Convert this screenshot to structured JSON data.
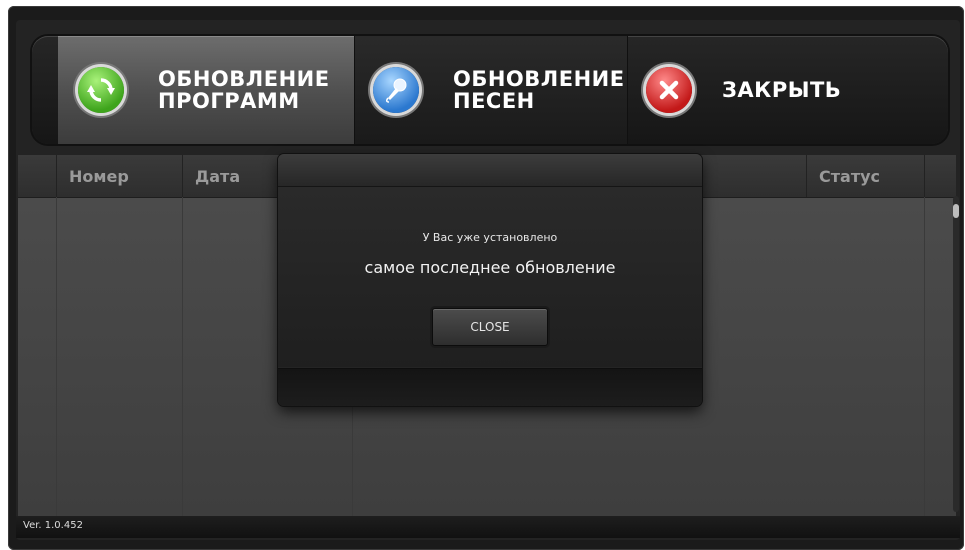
{
  "toolbar": {
    "update_programs": "ОБНОВЛЕНИЕ\nПРОГРАММ",
    "update_songs": "ОБНОВЛЕНИЕ\nПЕСЕН",
    "close": "ЗАКРЫТЬ",
    "icons": {
      "update_programs": "refresh-icon",
      "update_songs": "microphone-icon",
      "close": "close-x-icon"
    },
    "colors": {
      "refresh": "#3ea41c",
      "microphone": "#2b78cf",
      "close": "#c31919"
    }
  },
  "table": {
    "columns": {
      "number": "Номер",
      "date": "Дата",
      "status": "Статус"
    }
  },
  "modal": {
    "line1": "У Вас уже установлено",
    "line2": "самое последнее обновление",
    "close_button": "CLOSE"
  },
  "footer": {
    "version": "Ver. 1.0.452"
  }
}
